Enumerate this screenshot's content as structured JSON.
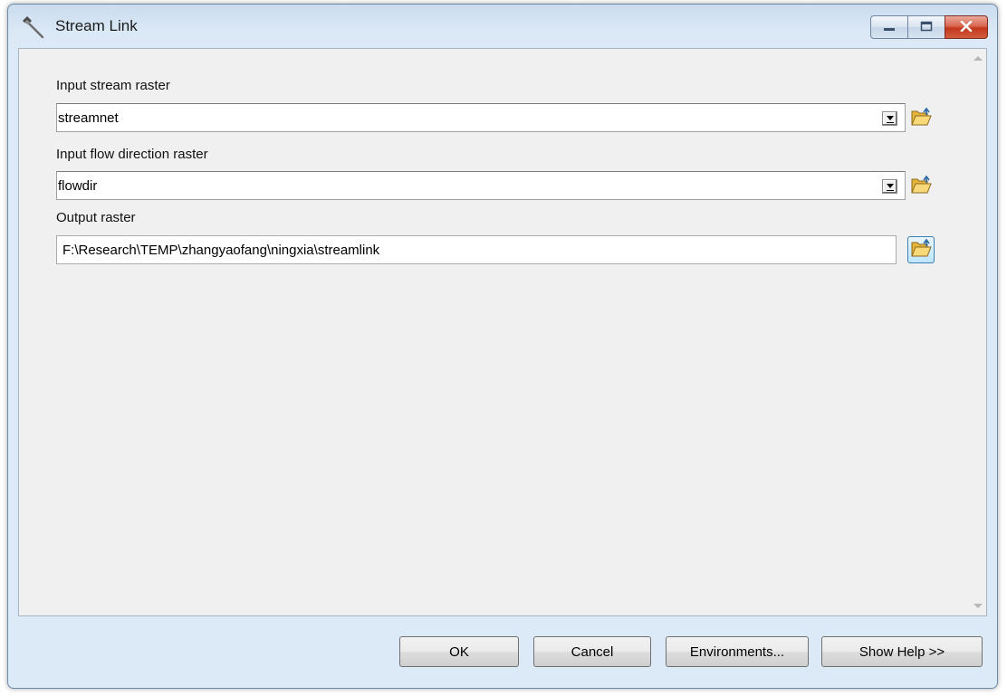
{
  "window": {
    "title": "Stream Link"
  },
  "params": [
    {
      "label": "Input stream raster",
      "value": "streamnet"
    },
    {
      "label": "Input flow direction raster",
      "value": "flowdir"
    },
    {
      "label": "Output raster",
      "value": "F:\\Research\\TEMP\\zhangyaofang\\ningxia\\streamlink"
    }
  ],
  "buttons": {
    "ok": "OK",
    "cancel": "Cancel",
    "environments": "Environments...",
    "show_help": "Show Help >>"
  },
  "icons": {
    "app": "hammer-icon",
    "browse": "open-folder-icon",
    "minimize": "minimize-icon",
    "maximize": "maximize-icon",
    "close": "close-icon"
  },
  "colors": {
    "title_bar": "#c9dcee",
    "client_bg": "#f0f0f0",
    "close_button": "#c2381e",
    "folder": "#f2c94c",
    "focus_border": "#3c7fb1"
  }
}
